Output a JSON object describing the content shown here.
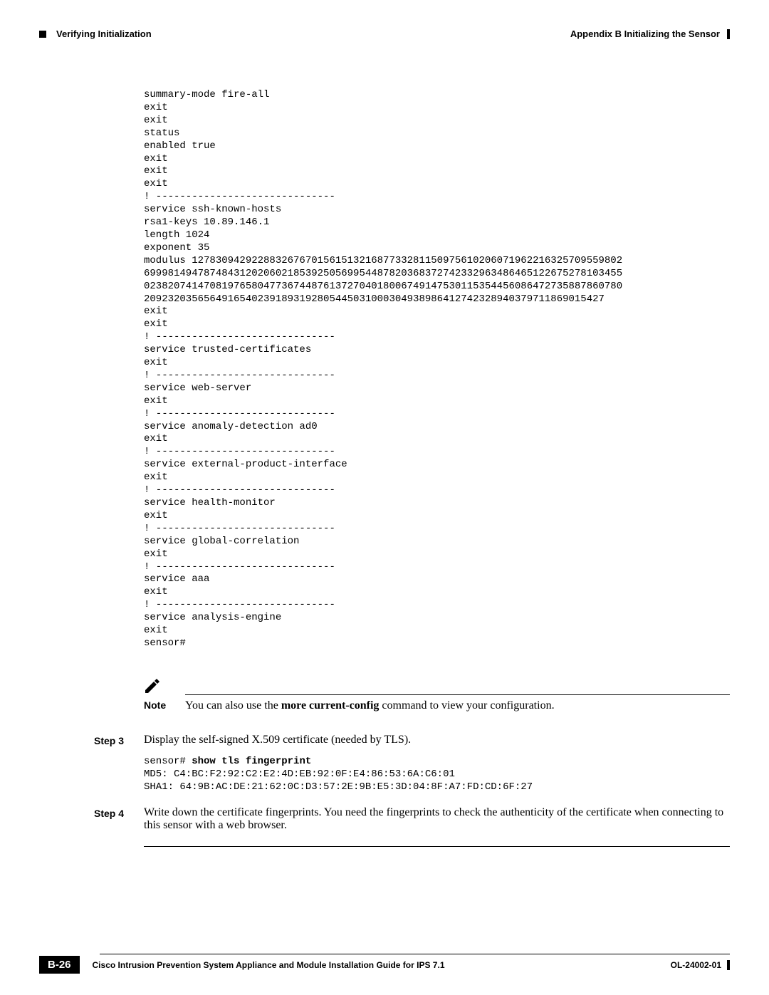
{
  "header": {
    "section": "Verifying Initialization",
    "appendix": "Appendix B     Initializing the Sensor"
  },
  "code_block": "summary-mode fire-all\nexit\nexit\nstatus\nenabled true\nexit\nexit\nexit\n! ------------------------------\nservice ssh-known-hosts\nrsa1-keys 10.89.146.1\nlength 1024\nexponent 35\nmodulus 127830942922883267670156151321687733281150975610206071962216325709559802\n69998149478748431202060218539250569954487820368372742332963486465122675278103455\n02382074147081976580477367448761372704018006749147530115354456086472735887860780\n20923203565649165402391893192805445031000304938986412742328940379711869015427\nexit\nexit\n! ------------------------------\nservice trusted-certificates\nexit\n! ------------------------------\nservice web-server\nexit\n! ------------------------------\nservice anomaly-detection ad0\nexit\n! ------------------------------\nservice external-product-interface\nexit\n! ------------------------------\nservice health-monitor\nexit\n! ------------------------------\nservice global-correlation\nexit\n! ------------------------------\nservice aaa\nexit\n! ------------------------------\nservice analysis-engine\nexit\nsensor#",
  "note": {
    "label": "Note",
    "text_before": "You can also use the ",
    "bold_cmd": "more current-config",
    "text_after": " command to view your configuration."
  },
  "step3": {
    "label": "Step 3",
    "text": "Display the self-signed X.509 certificate (needed by TLS).",
    "code_prompt": "sensor# ",
    "code_cmd": "show tls fingerprint",
    "code_rest": "MD5: C4:BC:F2:92:C2:E2:4D:EB:92:0F:E4:86:53:6A:C6:01\nSHA1: 64:9B:AC:DE:21:62:0C:D3:57:2E:9B:E5:3D:04:8F:A7:FD:CD:6F:27"
  },
  "step4": {
    "label": "Step 4",
    "text": "Write down the certificate fingerprints. You need the fingerprints to check the authenticity of the certificate when connecting to this sensor with a web browser."
  },
  "footer": {
    "title": "Cisco Intrusion Prevention System Appliance and Module Installation Guide for IPS 7.1",
    "page": "B-26",
    "docid": "OL-24002-01"
  }
}
